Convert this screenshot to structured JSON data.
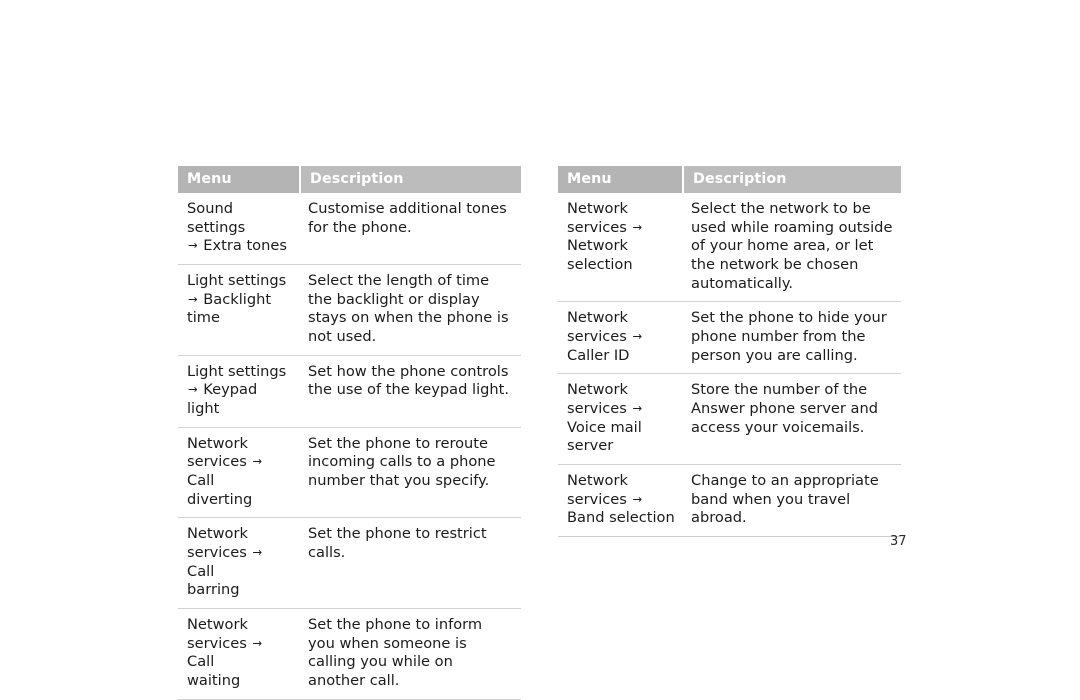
{
  "document": {
    "page_number": "37",
    "background_color": "#ffffff",
    "header_bg_color": "#b8b8b8",
    "header_text_color": "#ffffff",
    "rule_color": "#d2d2d2",
    "arrow_glyph": "→"
  },
  "tables": [
    {
      "id": "left-table",
      "headers": {
        "menu": "Menu",
        "description": "Description"
      },
      "rows": [
        {
          "menu_line1": "Sound settings",
          "menu_line2": "Extra tones",
          "menu_has_arrow": true,
          "description": "Customise additional tones for the phone."
        },
        {
          "menu_line1": "Light settings",
          "menu_line2": "Backlight",
          "menu_line3": "time",
          "menu_has_arrow": true,
          "description": "Select the length of time the backlight or display stays on when the phone is not used."
        },
        {
          "menu_line1": "Light settings",
          "menu_line2": "Keypad light",
          "menu_has_arrow": true,
          "description": "Set how the phone controls the use of the keypad light."
        },
        {
          "menu_line1": "Network",
          "menu_line2": "services",
          "menu_line2_tail": "Call",
          "menu_line3": "diverting",
          "menu_has_arrow": true,
          "description": "Set the phone to reroute incoming calls to a phone number that you specify."
        },
        {
          "menu_line1": "Network",
          "menu_line2": "services",
          "menu_line2_tail": "Call",
          "menu_line3": "barring",
          "menu_has_arrow": true,
          "description": "Set the phone to restrict calls."
        },
        {
          "menu_line1": "Network",
          "menu_line2": "services",
          "menu_line2_tail": "Call",
          "menu_line3": "waiting",
          "menu_has_arrow": true,
          "description": "Set the phone to inform you when someone is calling you while on another call."
        }
      ]
    },
    {
      "id": "right-table",
      "headers": {
        "menu": "Menu",
        "description": "Description"
      },
      "rows": [
        {
          "menu_line1": "Network",
          "menu_line2": "services",
          "menu_line3": "Network",
          "menu_line4": "selection",
          "menu_has_arrow": true,
          "description": "Select the network to be used while roaming outside of your home area, or let the network be chosen automatically."
        },
        {
          "menu_line1": "Network",
          "menu_line2": "services",
          "menu_line3": "Caller ID",
          "menu_has_arrow": true,
          "description": "Set the phone to hide your phone number from the person you are calling."
        },
        {
          "menu_line1": "Network",
          "menu_line2": "services",
          "menu_line3": "Voice mail",
          "menu_line4": "server",
          "menu_has_arrow": true,
          "description": "Store the number of the Answer phone server and access your voicemails."
        },
        {
          "menu_line1": "Network",
          "menu_line2": "services",
          "menu_line3": "Band selection",
          "menu_has_arrow": true,
          "description": "Change to an appropriate band when you travel abroad."
        }
      ]
    }
  ]
}
